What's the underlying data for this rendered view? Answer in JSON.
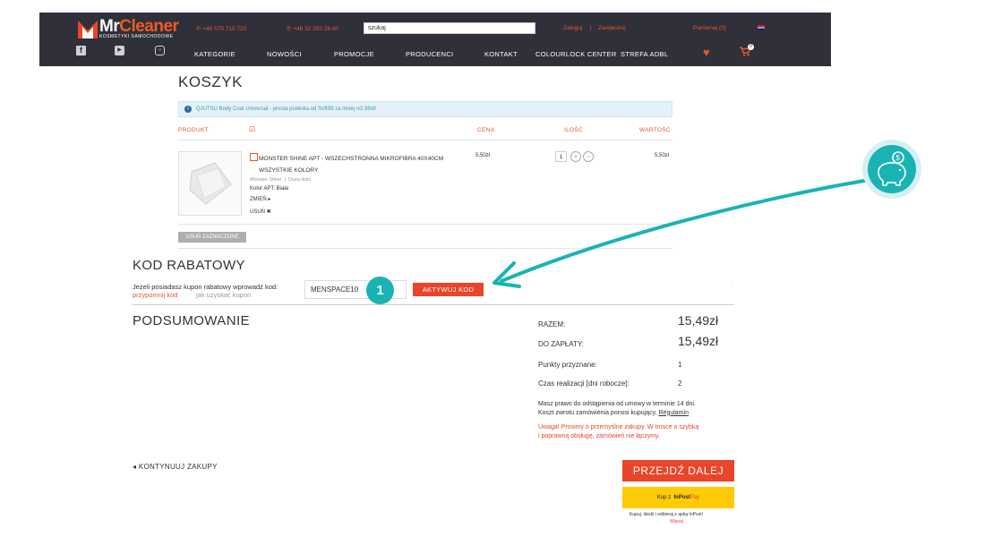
{
  "header": {
    "logo_main": "Mr",
    "logo_accent": "Cleaner",
    "logo_sub": "KOSMETYKI SAMOCHODOWE",
    "phone1": "+48 570 710 720",
    "phone2": "+48 32 350 28 60",
    "search_value": "szukaj",
    "login": "Zaloguj",
    "register": "Zarejestruj",
    "compare": "Porównaj (0)",
    "cart_count": "0"
  },
  "nav": [
    "KATEGORIE",
    "NOWOŚCI",
    "PROMOCJE",
    "PRODUCENCI",
    "KONTAKT",
    "COLOURLOCK CENTER",
    "STREFA ADBL"
  ],
  "page_title": "KOSZYK",
  "info_banner": "QJUTSU Body Coat Universal - prosta powłoka od Soft99 za mniej niż 89zł!",
  "table_headers": {
    "product": "PRODUKT",
    "price": "CENA",
    "quantity": "ILOŚĆ",
    "value": "WARTOŚĆ"
  },
  "item": {
    "name_line1": "MONSTER SHINE APT - WSZECHSTRONNA MIKROFIBRA 40X40CM",
    "name_line2": "WSZYSTKIE KOLORY",
    "brand": "Monster Shine",
    "tag": "Duża ilość",
    "color": "Kolor APT: Biała",
    "change": "ZMIEŃ",
    "remove": "USUŃ",
    "price": "5,50zł",
    "qty": "1",
    "total": "5,50zł"
  },
  "remove_selected": "USUŃ ZAZNACZONE",
  "coupon": {
    "title": "KOD RABATOWY",
    "prompt": "Jeżeli posiadasz kupon rabatowy wprowadź kod:",
    "remind": "przypomnij kod",
    "how": "jak uzyskać kupon",
    "value": "MENSPACE10",
    "activate": "AKTYWUJ KOD",
    "step": "1"
  },
  "summary": {
    "title": "PODSUMOWANIE",
    "total_label": "RAZEM:",
    "total": "15,49zł",
    "pay_label": "DO ZAPŁATY:",
    "pay": "15,49zł",
    "points_label": "Punkty przyznane:",
    "points": "1",
    "time_label": "Czas realizacji [dni robocze]:",
    "time": "2",
    "return_l1": "Masz prawo do odstąpienia od umowy w terminie 14 dni.",
    "return_l2": "Koszt zwrotu zamówienia ponosi kupujący.",
    "regulamin": "Regulamin",
    "warn_l1": "Uwaga! Prosimy o przemyślne zakupy. W trosce o szybką",
    "warn_l2": "i poprawną obsługę, zamówień nie łączymy."
  },
  "continue": "KONTYNUUJ ZAKUPY",
  "next": "PRZEJDŹ DALEJ",
  "inpost": {
    "prefix": "Kup z",
    "brand1": "InPost",
    "brand2": "Pay",
    "l1": "Kupuj, śledź i odbieraj z apką InPost!",
    "l2": "Więcej"
  },
  "colors": {
    "accent": "#e8452a",
    "teal": "#1ab3b3",
    "header": "#2f3039"
  }
}
